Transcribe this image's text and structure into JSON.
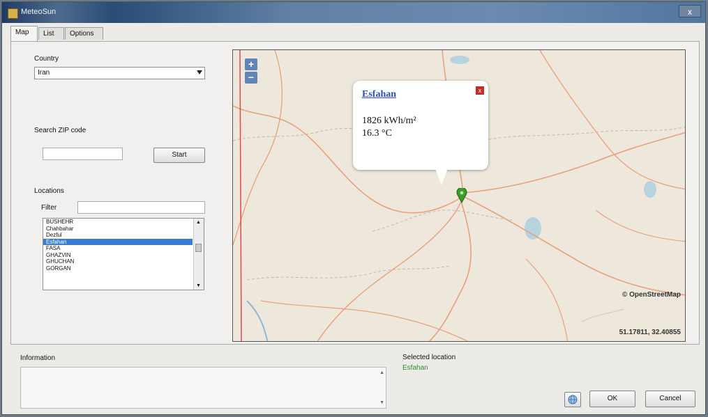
{
  "window": {
    "title": "MeteoSun",
    "close_label": "x"
  },
  "tabs": [
    {
      "label": "Map",
      "active": true
    },
    {
      "label": "List",
      "active": false
    },
    {
      "label": "Options",
      "active": false
    }
  ],
  "country": {
    "label": "Country",
    "value": "Iran"
  },
  "zip": {
    "label": "Search ZIP code",
    "value": "",
    "start_label": "Start"
  },
  "locations": {
    "label": "Locations",
    "filter_label": "Filter",
    "filter_value": "",
    "items": [
      "BUSHEHR",
      "Chahbahar",
      "Dezful",
      "Esfahan",
      "FASA",
      "GHAZVIN",
      "GHUCHAN",
      "GORGAN"
    ],
    "selected_index": 3
  },
  "map": {
    "zoom_in": "+",
    "zoom_out": "−",
    "attribution": "© OpenStreetMap",
    "coordinates": "51.17811, 32.40855",
    "popup": {
      "title": "Esfahan",
      "close": "x",
      "irradiation": "1826 kWh/m²",
      "temperature": "16.3 °C"
    }
  },
  "information": {
    "label": "Information",
    "text": ""
  },
  "selected_location": {
    "label": "Selected location",
    "value": "Esfahan",
    "value_color": "#2e8b2e"
  },
  "buttons": {
    "ok": "OK",
    "cancel": "Cancel"
  }
}
